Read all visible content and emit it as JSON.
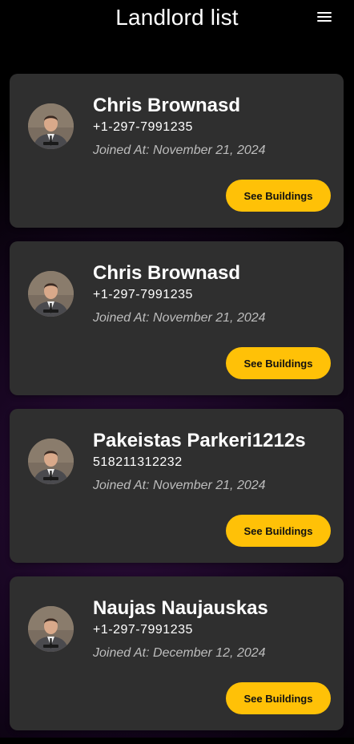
{
  "header": {
    "title": "Landlord list",
    "menu_icon": "hamburger-menu-icon"
  },
  "landlords": [
    {
      "name": "Chris Brownasd",
      "phone": "+1-297-7991235",
      "joined": "Joined At: November 21, 2024",
      "button_label": "See Buildings"
    },
    {
      "name": "Chris Brownasd",
      "phone": "+1-297-7991235",
      "joined": "Joined At: November 21, 2024",
      "button_label": "See Buildings"
    },
    {
      "name": "Pakeistas Parkeri1212s",
      "phone": "518211312232",
      "joined": "Joined At: November 21, 2024",
      "button_label": "See Buildings"
    },
    {
      "name": "Naujas Naujauskas",
      "phone": "+1-297-7991235",
      "joined": "Joined At: December 12, 2024",
      "button_label": "See Buildings"
    }
  ],
  "colors": {
    "card_bg": "#2f2f2f",
    "button_bg": "#ffc107",
    "button_text": "#111111",
    "joined_text": "#bdbdbd"
  }
}
